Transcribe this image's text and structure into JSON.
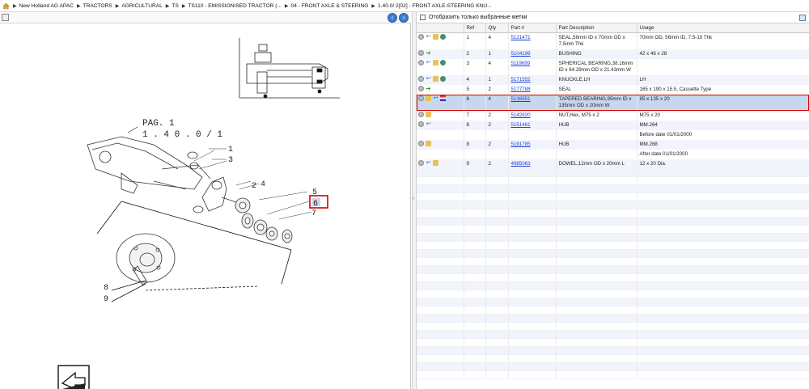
{
  "breadcrumb": [
    "New Holland AG APAC",
    "TRACTORS",
    "AGRICULTURAL",
    "TS",
    "TS110 - EMISSIONISED TRACTOR (...",
    "04 - FRONT AXLE & STEERING",
    "1.40.0/ 2[02] - FRONT AXLE-STEERING KNU..."
  ],
  "diagram": {
    "page_label_1": "PAG. 1",
    "page_label_2": "1 . 4 0 . 0 / 1",
    "callouts": [
      "1",
      "3",
      "2",
      "4",
      "5",
      "6",
      "7",
      "8",
      "9"
    ],
    "highlighted_callout": "6"
  },
  "filter": {
    "label": "Отобразить только выбранные метки"
  },
  "table": {
    "headers": [
      "Ref",
      "Qty",
      "Part #",
      "Part Description",
      "Usage"
    ],
    "rows": [
      {
        "ref": "1",
        "qty": "4",
        "part": "5121471",
        "desc": "SEAL,56mm ID x 70mm OD x 7.5mm Thk",
        "usage": "70mm OD, 56mm ID, 7.5-10 Thk",
        "icons": [
          "circle",
          "arrow",
          "tree",
          "globe"
        ]
      },
      {
        "ref": "2",
        "qty": "1",
        "part": "5104199",
        "desc": "BUSHING",
        "usage": "42 x 46 x 28",
        "icons": [
          "circle",
          "green-arrow"
        ]
      },
      {
        "ref": "3",
        "qty": "4",
        "part": "5119699",
        "desc": "SPHERICAL BEARING,38.16mm ID x 64.29mm OD x 21.43mm W",
        "usage": "",
        "icons": [
          "circle",
          "arrow",
          "tree",
          "globe"
        ]
      },
      {
        "ref": "4",
        "qty": "1",
        "part": "5171552",
        "desc": "KNUCKLE,LH",
        "usage": "LH",
        "icons": [
          "circle",
          "arrow",
          "tree",
          "globe"
        ]
      },
      {
        "ref": "5",
        "qty": "2",
        "part": "5177788",
        "desc": "SEAL",
        "usage": "165 x 190 x 15.5, Cassette Type",
        "icons": [
          "circle",
          "green-arrow"
        ]
      },
      {
        "ref": "6",
        "qty": "4",
        "part": "5136951",
        "desc": "TAPERED BEARING,95mm ID x 135mm OD x 20mm W",
        "usage": "95 x 135 x 20",
        "icons": [
          "circle",
          "folder",
          "arrow",
          "flag"
        ],
        "selected": true
      },
      {
        "ref": "7",
        "qty": "2",
        "part": "5142820",
        "desc": "NUT,Hex, M75 x 2",
        "usage": "M75 x 20",
        "icons": [
          "circle",
          "tree"
        ]
      },
      {
        "ref": "8",
        "qty": "2",
        "part": "5151461",
        "desc": "HUB",
        "usage": "MM.264",
        "icons": [
          "circle",
          "arrow"
        ]
      },
      {
        "ref": "",
        "qty": "",
        "part": "",
        "desc": "",
        "usage": "Before date 01/01/2000",
        "icons": []
      },
      {
        "ref": "8",
        "qty": "2",
        "part": "5191785",
        "desc": "HUB",
        "usage": "MM.268",
        "icons": [
          "circle",
          "folder"
        ]
      },
      {
        "ref": "",
        "qty": "",
        "part": "",
        "desc": "",
        "usage": "After date 01/01/2000",
        "icons": []
      },
      {
        "ref": "9",
        "qty": "2",
        "part": "4985063",
        "desc": "DOWEL,12mm OD x 20mm L",
        "usage": "12 x 20 Dia.",
        "icons": [
          "circle",
          "arrow",
          "tree"
        ]
      }
    ]
  }
}
